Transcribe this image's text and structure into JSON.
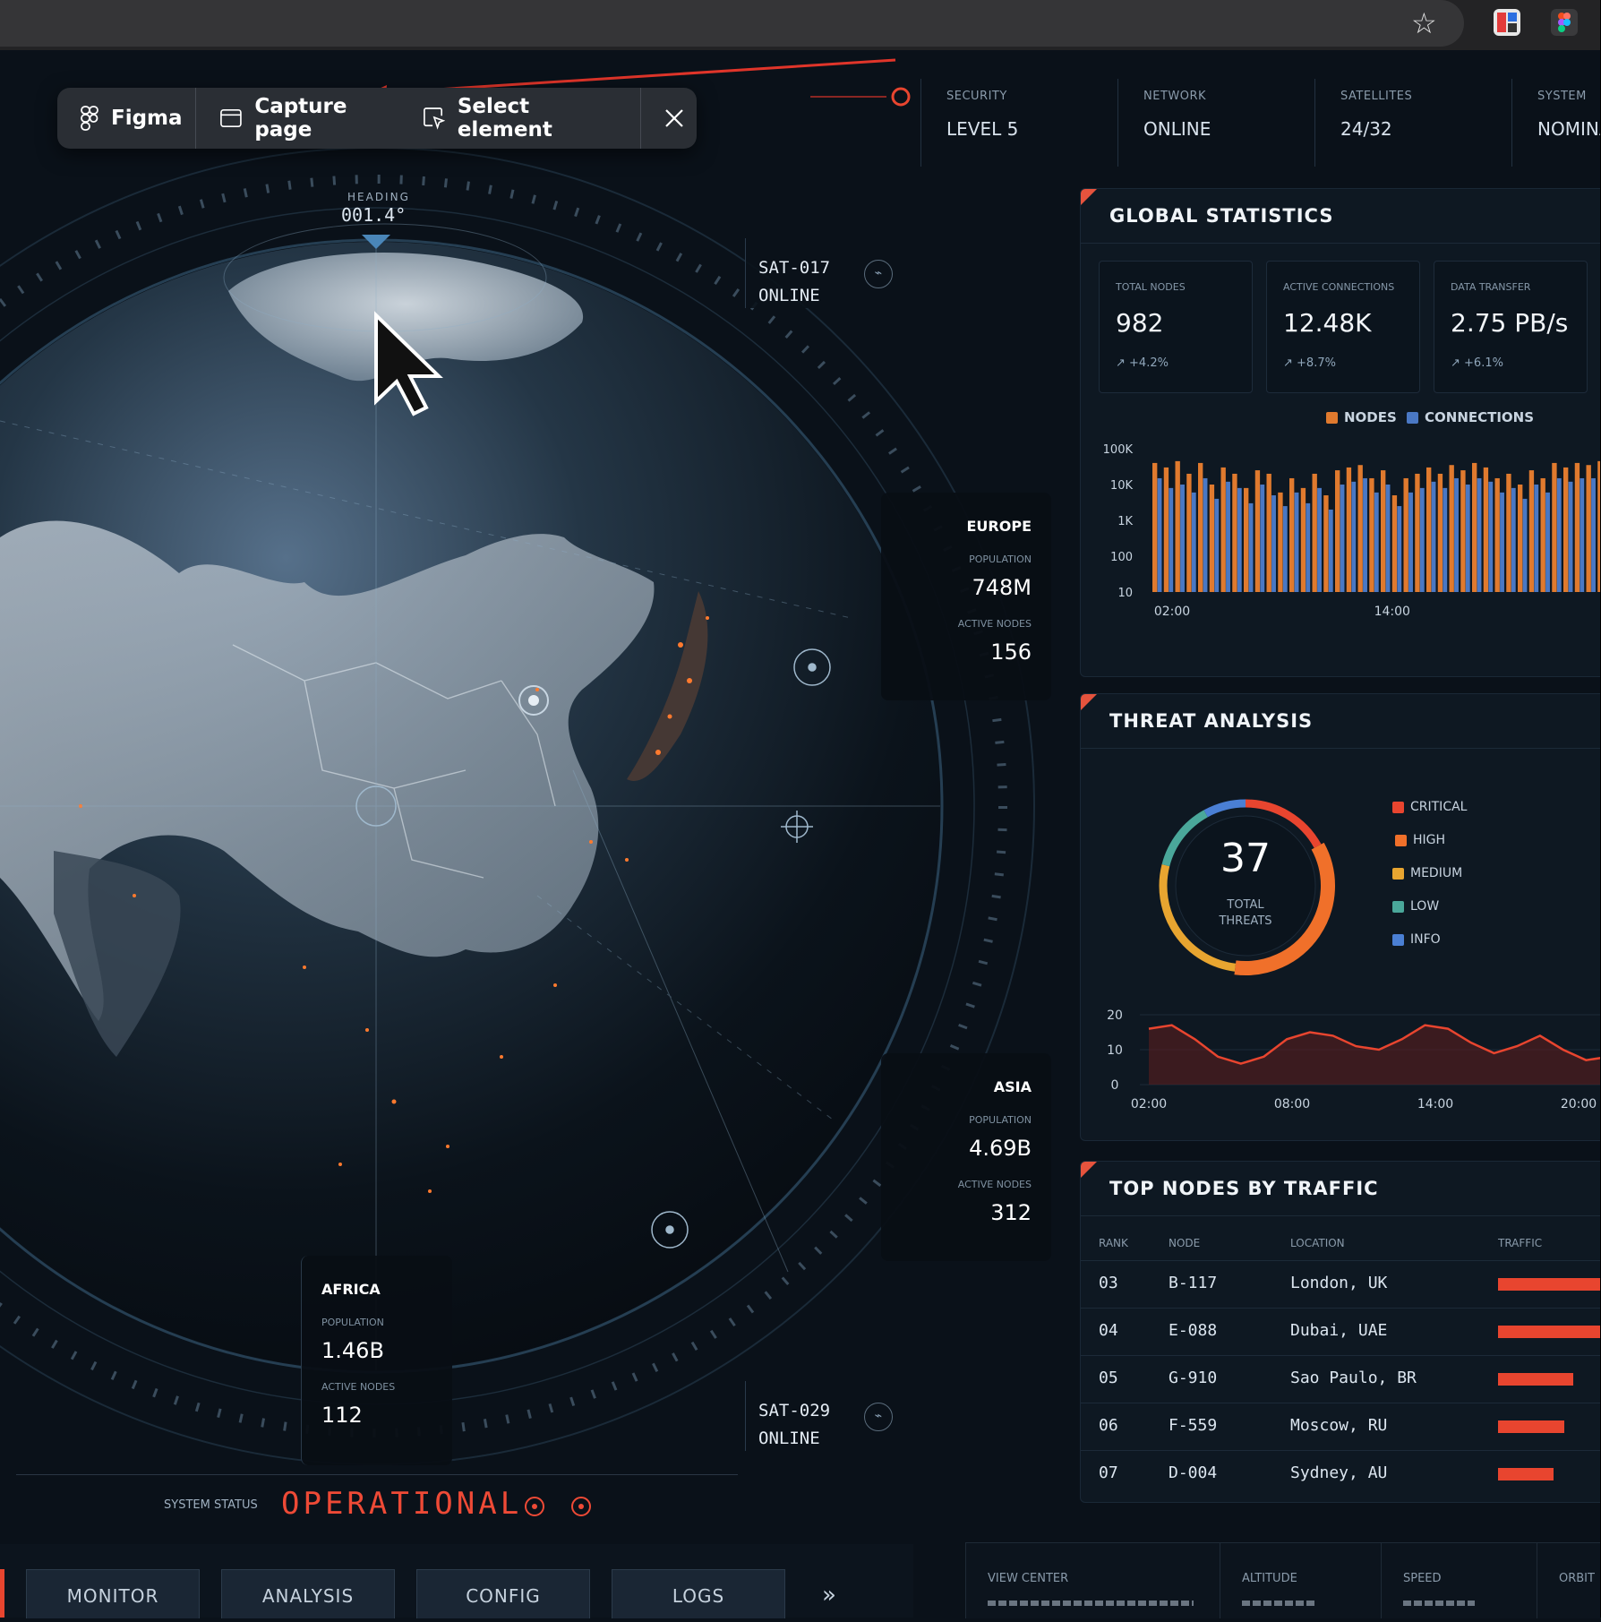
{
  "figma_toolbar": {
    "brand_label": "Figma",
    "capture_label": "Capture page",
    "select_label": "Select element"
  },
  "header": {
    "cells": [
      {
        "label": "SECURITY",
        "value": "LEVEL 5"
      },
      {
        "label": "NETWORK",
        "value": "ONLINE"
      },
      {
        "label": "SATELLITES",
        "value": "24/32"
      },
      {
        "label": "SYSTEM",
        "value": "NOMINA"
      }
    ]
  },
  "globe": {
    "heading_label": "HEADING",
    "heading_value": "001.4°"
  },
  "satellites": [
    {
      "name": "SAT-017",
      "status": "ONLINE"
    },
    {
      "name": "SAT-029",
      "status": "ONLINE"
    }
  ],
  "regions": {
    "europe": {
      "name": "EUROPE",
      "pop_label": "POPULATION",
      "pop": "748M",
      "nodes_label": "ACTIVE NODES",
      "nodes": "156"
    },
    "asia": {
      "name": "ASIA",
      "pop_label": "POPULATION",
      "pop": "4.69B",
      "nodes_label": "ACTIVE NODES",
      "nodes": "312"
    },
    "africa": {
      "name": "AFRICA",
      "pop_label": "POPULATION",
      "pop": "1.46B",
      "nodes_label": "ACTIVE NODES",
      "nodes": "112"
    }
  },
  "system_status": {
    "label": "SYSTEM STATUS",
    "value": "OPERATIONAL"
  },
  "bottom_nav": {
    "items": [
      "MONITOR",
      "ANALYSIS",
      "CONFIG",
      "LOGS"
    ],
    "more": "»"
  },
  "telemetry": {
    "labels": [
      "VIEW CENTER",
      "ALTITUDE",
      "SPEED",
      "ORBIT"
    ]
  },
  "global_stats": {
    "title": "GLOBAL STATISTICS",
    "boxes": [
      {
        "label": "TOTAL NODES",
        "value": "982",
        "delta": "+4.2%"
      },
      {
        "label": "ACTIVE CONNECTIONS",
        "value": "12.48K",
        "delta": "+8.7%"
      },
      {
        "label": "DATA TRANSFER",
        "value": "2.75 PB/s",
        "delta": "+6.1%"
      }
    ],
    "legend": [
      "NODES",
      "CONNECTIONS"
    ]
  },
  "threat": {
    "title": "THREAT ANALYSIS",
    "total": "37",
    "total_label_1": "TOTAL",
    "total_label_2": "THREATS",
    "legend": [
      "CRITICAL",
      "HIGH",
      "MEDIUM",
      "LOW",
      "INFO"
    ]
  },
  "top_nodes": {
    "title": "TOP NODES BY TRAFFIC",
    "columns": [
      "RANK",
      "NODE",
      "LOCATION",
      "TRAFFIC"
    ],
    "rows": [
      {
        "rank": "03",
        "node": "B-117",
        "location": "London, UK",
        "traffic": 0.95
      },
      {
        "rank": "04",
        "node": "E-088",
        "location": "Dubai, UAE",
        "traffic": 0.93
      },
      {
        "rank": "05",
        "node": "G-910",
        "location": "Sao Paulo, BR",
        "traffic": 0.68
      },
      {
        "rank": "06",
        "node": "F-559",
        "location": "Moscow, RU",
        "traffic": 0.6
      },
      {
        "rank": "07",
        "node": "D-004",
        "location": "Sydney, AU",
        "traffic": 0.5
      }
    ]
  },
  "colors": {
    "accent": "#e8452f",
    "nodes": "#e07a2e",
    "connections": "#4a78c4",
    "critical": "#e8452f",
    "high": "#f0702a",
    "medium": "#e8a530",
    "low": "#4aa79a",
    "info": "#4a7fd4"
  },
  "chart_data": [
    {
      "type": "bar",
      "yscale": "log",
      "ylim": [
        10,
        100000
      ],
      "y_ticks": [
        "100K",
        "10K",
        "1K",
        "100",
        "10"
      ],
      "x_ticks": [
        "02:00",
        "14:00"
      ],
      "series": [
        {
          "name": "NODES",
          "values": [
            40000,
            30000,
            45000,
            20000,
            40000,
            10000,
            30000,
            20000,
            8000,
            25000,
            20000,
            6000,
            15000,
            8000,
            20000,
            5000,
            25000,
            30000,
            35000,
            15000,
            25000,
            5000,
            15000,
            20000,
            30000,
            20000,
            35000,
            25000,
            40000,
            30000,
            15000,
            20000,
            10000,
            25000,
            15000,
            40000,
            30000,
            40000,
            35000,
            45000
          ]
        },
        {
          "name": "CONNECTIONS",
          "values": [
            15000,
            8000,
            10000,
            6000,
            15000,
            4000,
            12000,
            8000,
            3000,
            10000,
            5000,
            2500,
            6000,
            3000,
            8000,
            2000,
            10000,
            12000,
            15000,
            6000,
            10000,
            2500,
            6000,
            8000,
            12000,
            8000,
            15000,
            10000,
            15000,
            12000,
            6000,
            8000,
            4000,
            10000,
            6000,
            15000,
            12000,
            15000,
            15000,
            20000
          ]
        }
      ]
    },
    {
      "type": "pie",
      "title": "TOTAL THREATS",
      "categories": [
        "CRITICAL",
        "HIGH",
        "MEDIUM",
        "LOW",
        "INFO"
      ],
      "values": [
        0.17,
        0.35,
        0.27,
        0.13,
        0.08
      ]
    },
    {
      "type": "area",
      "x_ticks": [
        "02:00",
        "08:00",
        "14:00",
        "20:00"
      ],
      "y_ticks": [
        20,
        10,
        0
      ],
      "ylim": [
        0,
        20
      ],
      "x": [
        0,
        1,
        2,
        3,
        4,
        5,
        6,
        7,
        8,
        9,
        10,
        11,
        12,
        13,
        14,
        15,
        16,
        17,
        18,
        19,
        20
      ],
      "values": [
        16,
        17,
        13,
        8,
        6,
        8,
        13,
        15,
        14,
        11,
        10,
        13,
        17,
        16,
        12,
        9,
        11,
        14,
        10,
        7,
        8
      ]
    }
  ]
}
